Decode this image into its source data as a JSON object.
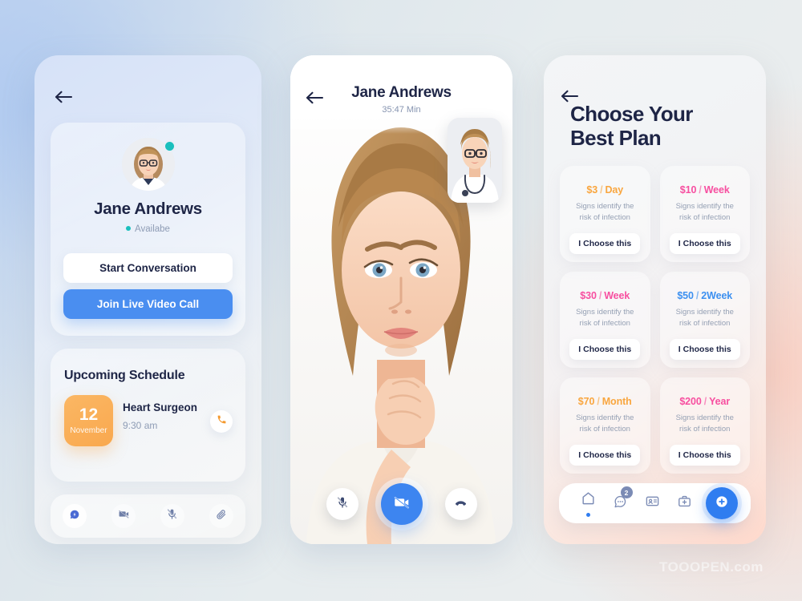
{
  "canvas": {
    "watermark": "TOOOPEN.com"
  },
  "colors": {
    "accent_blue": "#4a8ef0",
    "nav_blue": "#2f7df0",
    "status_teal": "#1abfbd",
    "date_orange": "#f9a84e",
    "price_orange": "#f9a63f",
    "price_pink": "#f74fa0",
    "price_blue": "#3d90f0",
    "text_dark": "#1e2546",
    "text_muted": "#8e9cb5"
  },
  "phone1": {
    "back_icon": "arrow-left-icon",
    "profile": {
      "avatar": "doctor-avatar",
      "status_indicator": "online-status-dot",
      "name": "Jane Andrews",
      "availability": "Availabe",
      "start_conversation_label": "Start Conversation",
      "join_call_label": "Join Live Video Call"
    },
    "schedule": {
      "title": "Upcoming Schedule",
      "item": {
        "day": "12",
        "month": "November",
        "title": "Heart Surgeon",
        "time": "9:30 am",
        "action_icon": "phone-call-icon"
      }
    },
    "toolbar": [
      {
        "icon": "chat-bolt-icon",
        "active": true
      },
      {
        "icon": "video-off-icon",
        "active": false
      },
      {
        "icon": "mic-off-icon",
        "active": false
      },
      {
        "icon": "attachment-icon",
        "active": false
      }
    ]
  },
  "phone2": {
    "back_icon": "arrow-left-icon",
    "caller_name": "Jane Andrews",
    "call_duration": "35:47 Min",
    "self_view": "doctor-pip-video",
    "main_view": "patient-video",
    "controls": [
      {
        "icon": "mic-off-icon",
        "style": "white"
      },
      {
        "icon": "video-off-icon",
        "style": "primary"
      },
      {
        "icon": "end-call-icon",
        "style": "white"
      }
    ]
  },
  "phone3": {
    "back_icon": "arrow-left-icon",
    "title_line1": "Choose Your",
    "title_line2": "Best Plan",
    "plans": [
      {
        "price": "$3",
        "sep": "/",
        "period": "Day",
        "color": "#f9a63f",
        "desc": "Signs identify the\nrisk of infection",
        "button": "I Choose this"
      },
      {
        "price": "$10",
        "sep": "/",
        "period": "Week",
        "color": "#f74fa0",
        "desc": "Signs identify the\nrisk of infection",
        "button": "I Choose this"
      },
      {
        "price": "$30",
        "sep": "/",
        "period": "Week",
        "color": "#f74fa0",
        "desc": "Signs identify the\nrisk of infection",
        "button": "I Choose this"
      },
      {
        "price": "$50",
        "sep": "/",
        "period": "2Week",
        "color": "#3d90f0",
        "desc": "Signs identify the\nrisk of infection",
        "button": "I Choose this"
      },
      {
        "price": "$70",
        "sep": "/",
        "period": "Month",
        "color": "#f9a63f",
        "desc": "Signs identify the\nrisk of infection",
        "button": "I Choose this"
      },
      {
        "price": "$200",
        "sep": "/",
        "period": "Year",
        "color": "#f74fa0",
        "desc": "Signs identify the\nrisk of infection",
        "button": "I Choose this"
      }
    ],
    "navbar": [
      {
        "icon": "home-icon",
        "active": true,
        "badge": null
      },
      {
        "icon": "chat-icon",
        "active": false,
        "badge": "2"
      },
      {
        "icon": "id-card-icon",
        "active": false,
        "badge": null
      },
      {
        "icon": "medkit-icon",
        "active": false,
        "badge": null
      }
    ],
    "navbar_fab": "add-circle-icon"
  }
}
